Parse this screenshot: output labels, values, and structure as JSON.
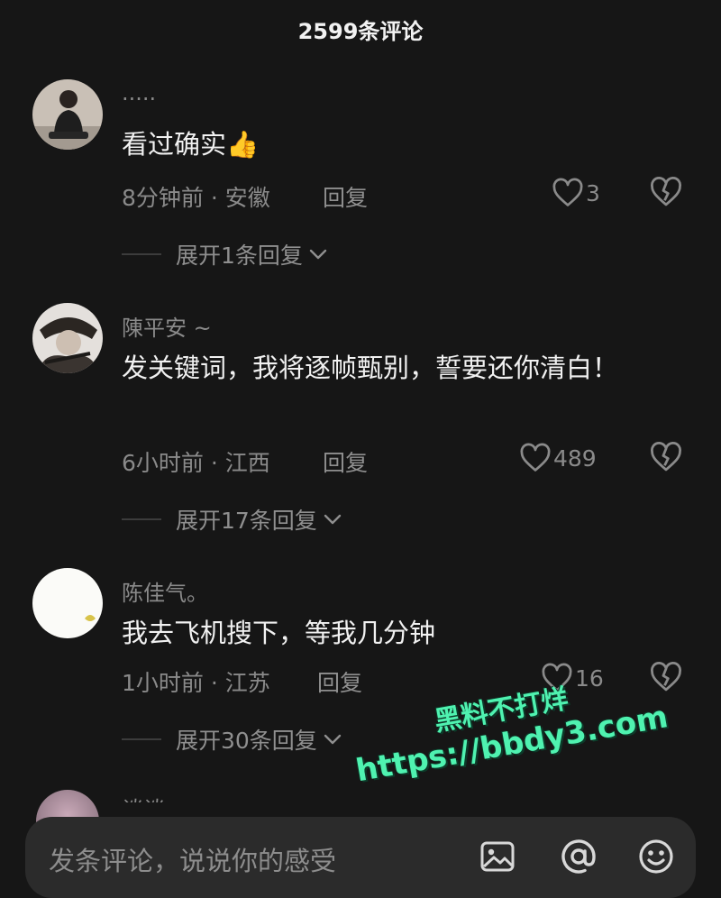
{
  "header": {
    "title": "2599条评论"
  },
  "comments": [
    {
      "username": "·····",
      "text": "看过确实",
      "emoji": "👍",
      "time": "8分钟前",
      "location": "安徽",
      "reply_label": "回复",
      "likes": "3",
      "expand_label": "展开1条回复"
    },
    {
      "username": "陳平安 ~",
      "text": "发关键词，我将逐帧甄别，誓要还你清白！",
      "time": "6小时前",
      "location": "江西",
      "reply_label": "回复",
      "likes": "489",
      "expand_label": "展开17条回复"
    },
    {
      "username": "陈佳气。",
      "text": "我去飞机搜下，等我几分钟",
      "time": "1小时前",
      "location": "江苏",
      "reply_label": "回复",
      "likes": "16",
      "expand_label": "展开30条回复"
    }
  ],
  "partial_comment": {
    "username": "谈谈"
  },
  "meta_separator": " · ",
  "input": {
    "placeholder": "发条评论，说说你的感受"
  },
  "watermark": {
    "line1": "黑料不打烊",
    "line2": "https://bbdy3.com"
  },
  "icons": {
    "like": "heart-outline-icon",
    "dislike": "broken-heart-icon",
    "expand": "chevron-down-icon",
    "image": "image-icon",
    "mention": "at-sign-icon",
    "emoji": "smiley-icon"
  },
  "colors": {
    "background": "#161616",
    "muted_text": "#8a8a8a",
    "watermark": "#4ff2b0"
  }
}
